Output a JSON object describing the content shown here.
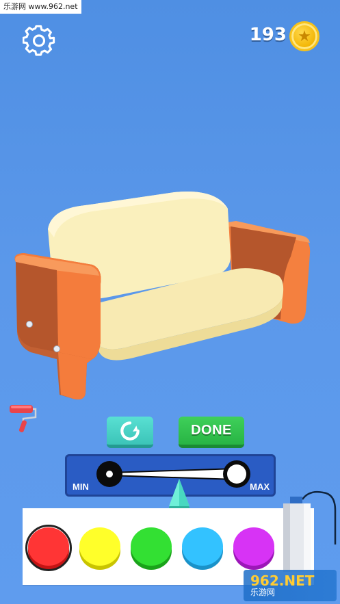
{
  "watermark_top": "乐游网 www.962.net",
  "hud": {
    "settings_icon": "gear-icon",
    "coin_count": "193",
    "coin_icon": "star-coin-icon"
  },
  "buttons": {
    "reset_icon": "rotate-icon",
    "done_label": "DONE"
  },
  "slider": {
    "min_label": "MIN",
    "max_label": "MAX",
    "value": 0.55
  },
  "palette": {
    "colors": [
      {
        "name": "red",
        "top": "#ff3535",
        "side": "#c51414",
        "selected": true
      },
      {
        "name": "yellow",
        "top": "#ffff2a",
        "side": "#c9c400",
        "selected": false
      },
      {
        "name": "green",
        "top": "#33e033",
        "side": "#1aa31a",
        "selected": false
      },
      {
        "name": "light-blue",
        "top": "#33c2ff",
        "side": "#1a92c9",
        "selected": false
      },
      {
        "name": "purple",
        "top": "#d733f5",
        "side": "#9c17b8",
        "selected": false
      }
    ]
  },
  "watermark_bottom": {
    "brand": "962.NET",
    "sub": "乐游网"
  },
  "colors": {
    "background": "#5b98ea",
    "sofa_cushion": "#fbf2c0",
    "sofa_arm": "#f47c3c",
    "done_green": "#2cb84a",
    "reset_teal": "#4fd6ca"
  }
}
